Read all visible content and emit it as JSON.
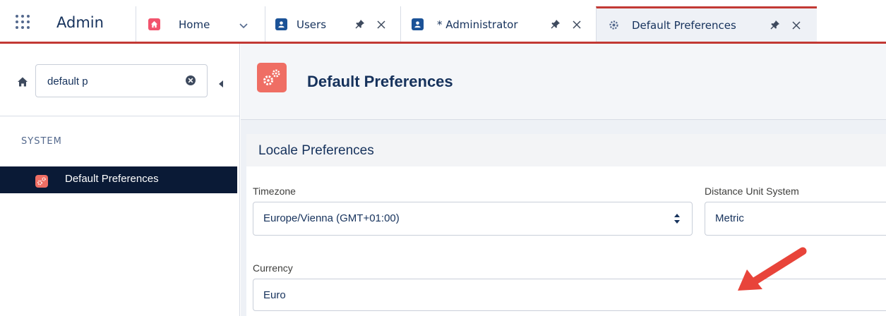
{
  "app": {
    "name": "Admin"
  },
  "tabs": [
    {
      "label": "Home",
      "icon": "home-icon",
      "color": "#f2536d"
    },
    {
      "label": "Users",
      "icon": "user-icon",
      "color": "#1b5297"
    },
    {
      "label": "* Administrator",
      "icon": "user-icon",
      "color": "#1b5297"
    },
    {
      "label": "Default Preferences",
      "icon": "gears-icon",
      "active": true
    }
  ],
  "sidebar": {
    "search": {
      "value": "default p"
    },
    "section": "SYSTEM",
    "items": [
      {
        "label": "Default Preferences",
        "icon": "gears-icon",
        "selected": true
      }
    ]
  },
  "page": {
    "title": "Default Preferences"
  },
  "locale": {
    "title": "Locale Preferences",
    "timezone": {
      "label": "Timezone",
      "value": "Europe/Vienna (GMT+01:00)"
    },
    "distance": {
      "label": "Distance Unit System",
      "value": "Metric"
    },
    "currency": {
      "label": "Currency",
      "value": "Euro"
    }
  },
  "colors": {
    "accent": "#c23934",
    "nav_selected": "#0a1a36",
    "setup_icon": "#ef6e64",
    "annotation_arrow": "#e8443a"
  }
}
